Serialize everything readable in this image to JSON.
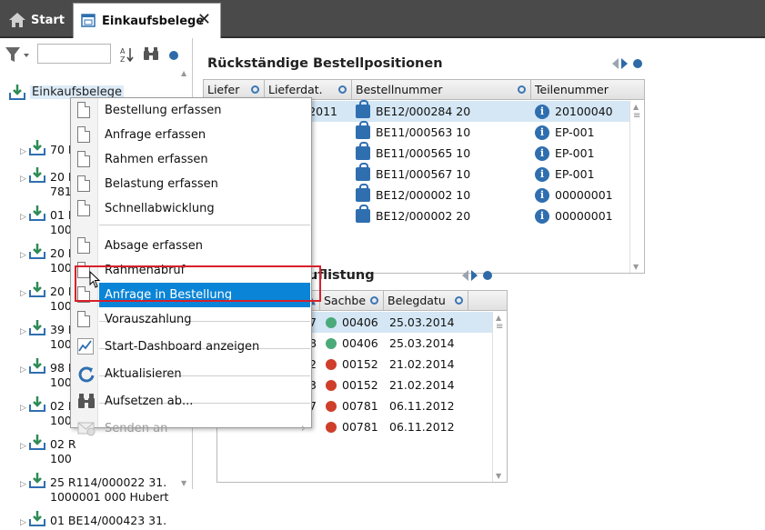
{
  "tabs": [
    {
      "label": "Start"
    },
    {
      "label": "Einkaufsbelege",
      "close": "✕"
    }
  ],
  "colors": {
    "accent": "#0a84d6",
    "selected_row": "#d5e7f5",
    "status_green": "#4aaa7a",
    "status_red": "#cf3e2a",
    "highlight_border": "#d8202a",
    "icon_blue": "#2f6fb0"
  },
  "sidebar": {
    "filter_value": "",
    "root": {
      "label": "Einkaufsbelege"
    },
    "items": [
      {
        "line1": "70 R",
        "line2": ""
      },
      {
        "line1": "20 R",
        "line2": "781"
      },
      {
        "line1": "01 B",
        "line2": "100"
      },
      {
        "line1": "20 R",
        "line2": "100"
      },
      {
        "line1": "20 R",
        "line2": "100"
      },
      {
        "line1": "39 R",
        "line2": "100"
      },
      {
        "line1": "98 R",
        "line2": "100"
      },
      {
        "line1": "02 R",
        "line2": "100"
      },
      {
        "line1": "02 R",
        "line2": "100"
      },
      {
        "line1": "25 R114/000022 31.",
        "line2": "1000001 000 Hubert"
      },
      {
        "line1": "01 BE14/000423 31.",
        "line2": ""
      }
    ]
  },
  "panel1": {
    "title": "Rückständige Bestellpositionen",
    "columns": [
      "Liefer",
      "Lieferdat.",
      "Bestellnummer",
      "Teilenummer"
    ],
    "rows": [
      {
        "liefer": "",
        "lieferdat": "2011",
        "bestellnummer": "BE12/000284 20",
        "teilenummer": "20100040"
      },
      {
        "liefer": "",
        "lieferdat": "",
        "bestellnummer": "BE11/000563 10",
        "teilenummer": "EP-001"
      },
      {
        "liefer": "",
        "lieferdat": "",
        "bestellnummer": "BE11/000565 10",
        "teilenummer": "EP-001"
      },
      {
        "liefer": "",
        "lieferdat": "",
        "bestellnummer": "BE11/000567 10",
        "teilenummer": "EP-001"
      },
      {
        "liefer": "",
        "lieferdat": "",
        "bestellnummer": "BE12/000002 10",
        "teilenummer": "00000001"
      },
      {
        "liefer": "",
        "lieferdat": "",
        "bestellnummer": "BE12/000002 20",
        "teilenummer": "00000001"
      }
    ]
  },
  "panel2": {
    "title": "uflistung",
    "columns": [
      "",
      "Sachbe",
      "Belegdatu"
    ],
    "rows": [
      {
        "id": "077",
        "sachbe": "00406",
        "datum": "25.03.2014",
        "status": "green"
      },
      {
        "id": "078",
        "sachbe": "00406",
        "datum": "25.03.2014",
        "status": "green"
      },
      {
        "id": "002",
        "sachbe": "00152",
        "datum": "21.02.2014",
        "status": "red"
      },
      {
        "id": "003",
        "sachbe": "00152",
        "datum": "21.02.2014",
        "status": "red"
      },
      {
        "id": "257",
        "sachbe": "00781",
        "datum": "06.11.2012",
        "status": "red"
      },
      {
        "id": "",
        "sachbe": "00781",
        "datum": "06.11.2012",
        "status": "red"
      }
    ]
  },
  "context_menu": {
    "items": [
      {
        "label": "Bestellung erfassen",
        "icon": "document-icon"
      },
      {
        "label": "Anfrage erfassen",
        "icon": "document-icon"
      },
      {
        "label": "Rahmen erfassen",
        "icon": "document-icon"
      },
      {
        "label": "Belastung erfassen",
        "icon": "document-icon"
      },
      {
        "label": "Schnellabwicklung",
        "icon": "document-icon"
      },
      {
        "label": "Absage erfassen",
        "icon": "document-icon"
      },
      {
        "label": "Rahmenabruf",
        "icon": "document-icon"
      },
      {
        "label": "Anfrage in Bestellung",
        "icon": "document-icon"
      },
      {
        "label": "Vorauszahlung",
        "icon": "document-icon"
      },
      {
        "label": "Start-Dashboard anzeigen",
        "icon": "chart-icon"
      },
      {
        "label": "Aktualisieren",
        "icon": "refresh-icon"
      },
      {
        "label": "Aufsetzen ab...",
        "icon": "binoculars-icon"
      },
      {
        "label": "Senden an",
        "icon": "mail-icon",
        "submenu_arrow": "›"
      }
    ]
  }
}
